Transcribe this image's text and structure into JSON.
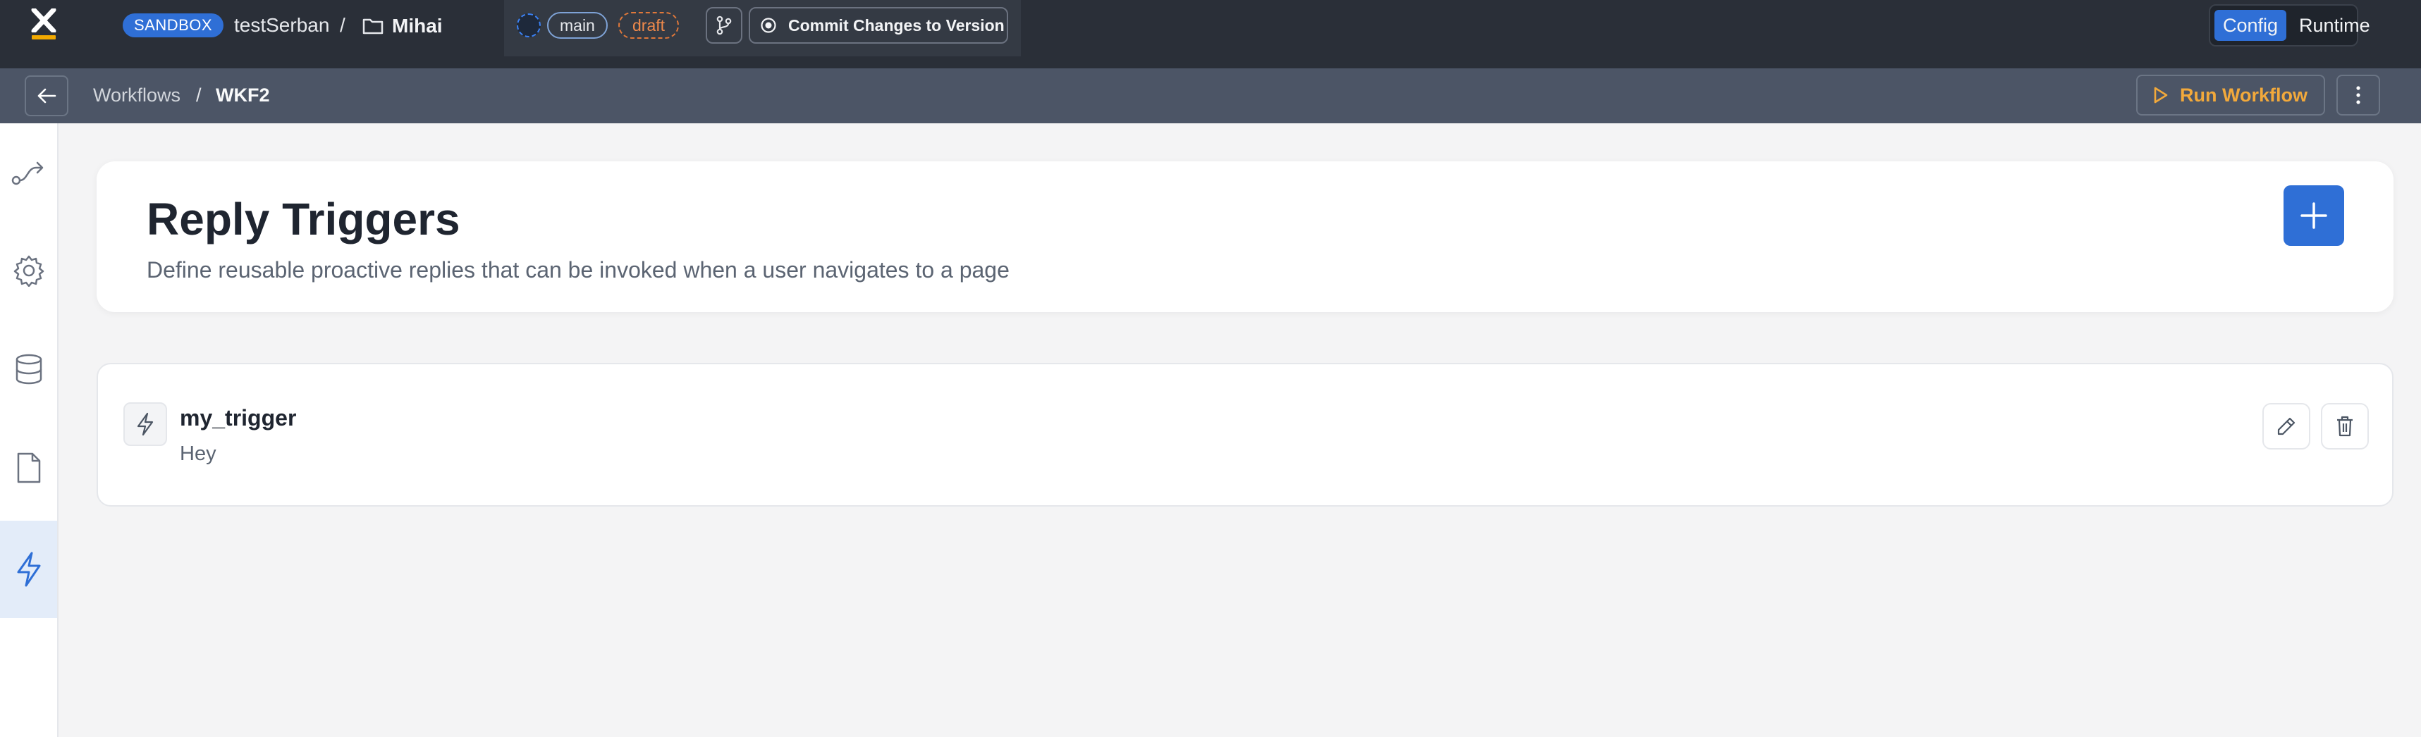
{
  "app": {
    "environment_badge": "SANDBOX",
    "workspace": "testSerban",
    "separator": "/",
    "folder": "Mihai"
  },
  "branch": {
    "main_label": "main",
    "draft_label": "draft",
    "commit_label": "Commit Changes to Version"
  },
  "mode_toggle": {
    "options": [
      "Config",
      "Runtime"
    ],
    "selected": "Config"
  },
  "breadcrumb": {
    "root": "Workflows",
    "separator": "/",
    "current": "WKF2"
  },
  "toolbar": {
    "run_label": "Run Workflow"
  },
  "sidebar": {
    "items": [
      {
        "icon": "workflow-route-icon",
        "active": false
      },
      {
        "icon": "gear-icon",
        "active": false
      },
      {
        "icon": "database-icon",
        "active": false
      },
      {
        "icon": "document-icon",
        "active": false
      },
      {
        "icon": "lightning-icon",
        "active": true
      }
    ]
  },
  "page": {
    "title": "Reply Triggers",
    "subtitle": "Define reusable proactive replies that can be invoked when a user navigates to a page"
  },
  "triggers": [
    {
      "name": "my_trigger",
      "description": "Hey"
    }
  ],
  "colors": {
    "accent": "#2f6fd6",
    "run_accent": "#f2a93b",
    "draft_accent": "#f08a4b",
    "topbar": "#2a2f38",
    "subbar": "#4c5566"
  }
}
